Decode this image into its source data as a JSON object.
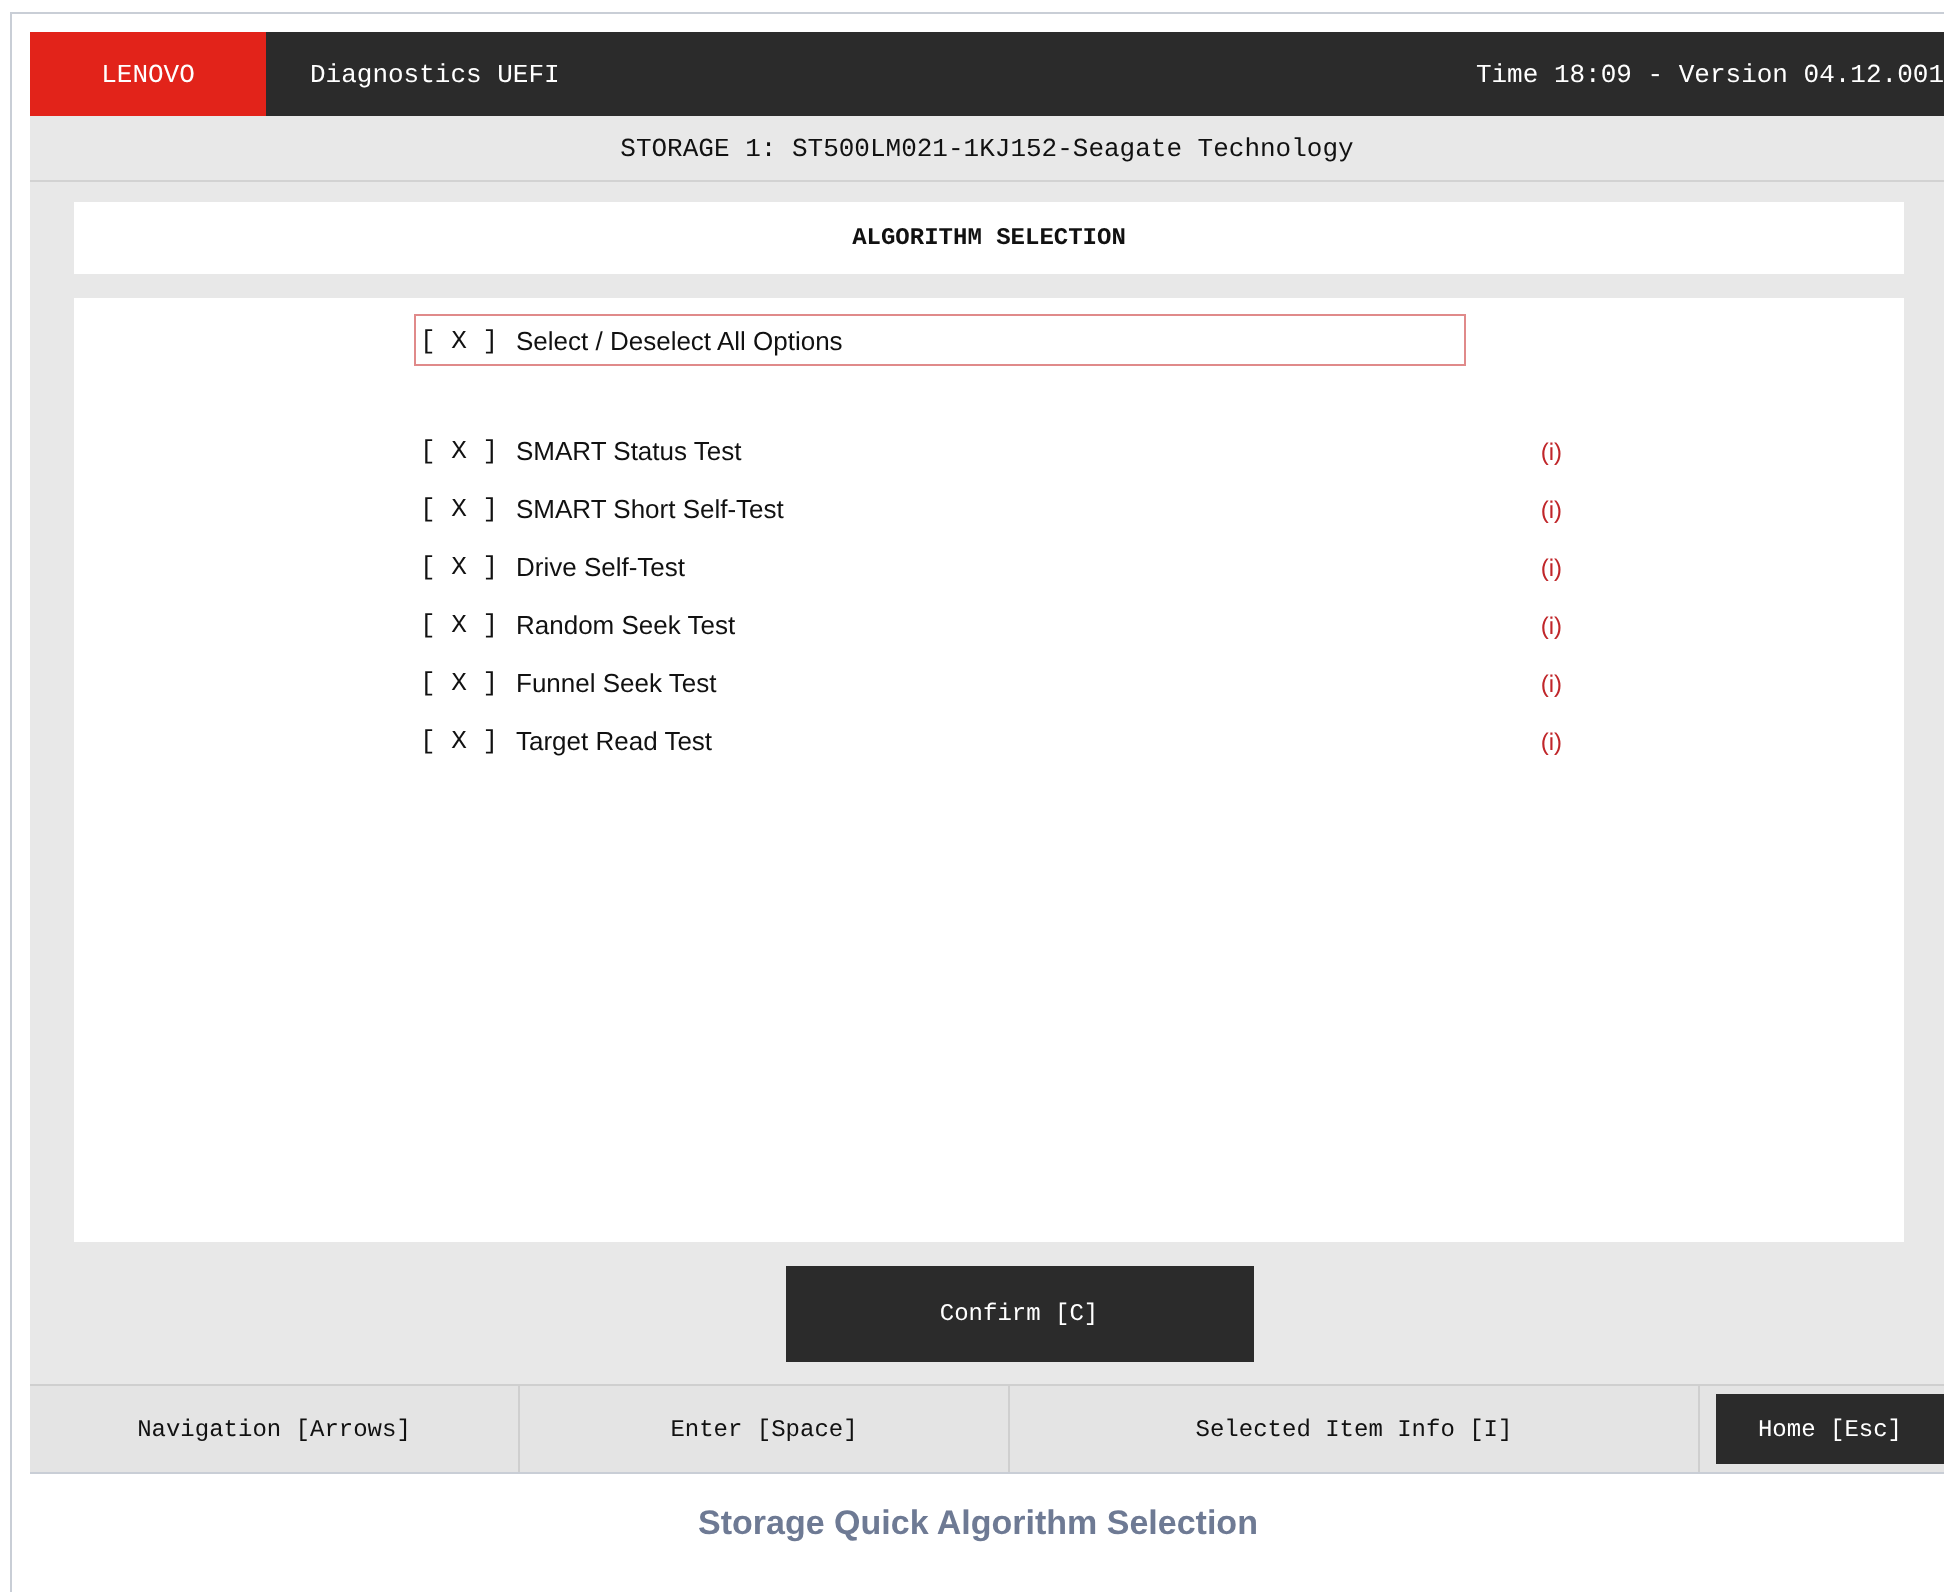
{
  "header": {
    "logo": "LENOVO",
    "title": "Diagnostics UEFI",
    "time_version": "Time 18:09 - Version 04.12.001"
  },
  "device": "STORAGE 1: ST500LM021-1KJ152-Seagate Technology",
  "panel_title": "ALGORITHM SELECTION",
  "select_all": {
    "box": "[ X ]",
    "label": "Select / Deselect All Options",
    "focused": true
  },
  "algorithms": [
    {
      "box": "[ X ]",
      "label": "SMART Status Test",
      "info": "(i)",
      "focused": false
    },
    {
      "box": "[ X ]",
      "label": "SMART Short Self-Test",
      "info": "(i)",
      "focused": false
    },
    {
      "box": "[ X ]",
      "label": "Drive Self-Test",
      "info": "(i)",
      "focused": false
    },
    {
      "box": "[ X ]",
      "label": "Random Seek Test",
      "info": "(i)",
      "focused": false
    },
    {
      "box": "[ X ]",
      "label": "Funnel Seek Test",
      "info": "(i)",
      "focused": false
    },
    {
      "box": "[ X ]",
      "label": "Target Read Test",
      "info": "(i)",
      "focused": false
    }
  ],
  "confirm_button": "Confirm [C]",
  "footer": [
    {
      "label": "Navigation [Arrows]",
      "highlighted": false
    },
    {
      "label": "Enter [Space]",
      "highlighted": false
    },
    {
      "label": "Selected Item Info [I]",
      "highlighted": false
    },
    {
      "label": "Home [Esc]",
      "highlighted": true
    }
  ],
  "caption": "Storage Quick Algorithm Selection"
}
